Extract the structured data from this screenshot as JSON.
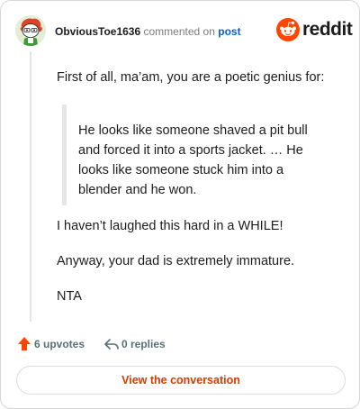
{
  "header": {
    "username": "ObviousToe1636",
    "action_text": "commented on",
    "post_link": "post",
    "brand": "reddit"
  },
  "comment": {
    "intro": "First of all, ma’am, you are a poetic genius for:",
    "quote": "He looks like someone shaved a pit bull and forced it into a sports jacket. … He looks like someone stuck him into a blender and he won.",
    "para2": "I haven’t laughed this hard in a WHILE!",
    "para3": "Anyway, your dad is extremely immature.",
    "para4": "NTA"
  },
  "footer": {
    "upvotes": "6 upvotes",
    "replies": "0 replies",
    "view_button": "View the conversation"
  },
  "colors": {
    "brand_orange": "#ff4500",
    "link_blue": "#0a5fc4",
    "button_text": "#d93a00"
  }
}
